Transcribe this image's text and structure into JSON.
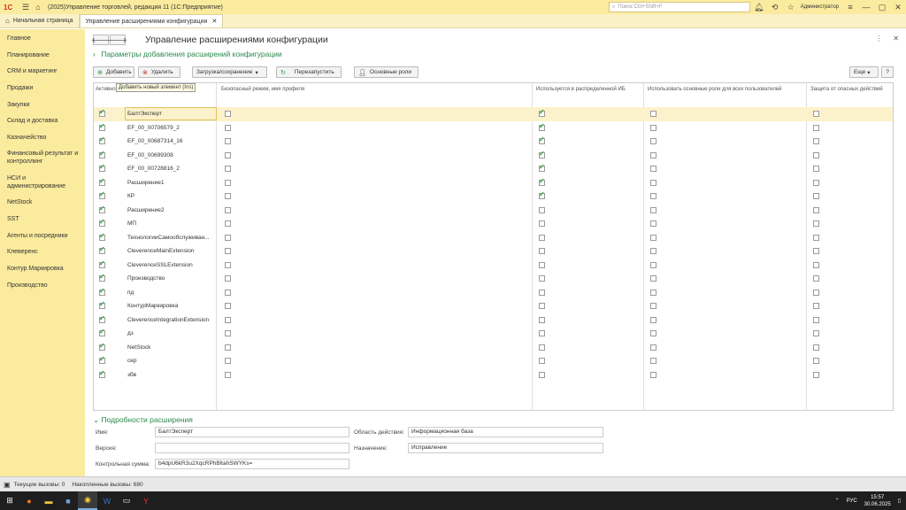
{
  "titlebar": {
    "app_title": "(2025)Управление торговлей, редакция 11  (1С:Предприятие)",
    "search_placeholder": "Поиск Ctrl+Shift+F",
    "user": "Администратор"
  },
  "tabs": [
    {
      "label": "Начальная страница"
    },
    {
      "label": "Управление расширениями конфигурации"
    }
  ],
  "sidebar": {
    "items": [
      {
        "label": "Главное"
      },
      {
        "label": "Планирование"
      },
      {
        "label": "CRM и маркетинг"
      },
      {
        "label": "Продажи"
      },
      {
        "label": "Закупки"
      },
      {
        "label": "Склад и доставка"
      },
      {
        "label": "Казначейство"
      },
      {
        "label": "Финансовый результат и контроллинг"
      },
      {
        "label": "НСИ и администрирование"
      },
      {
        "label": "NetStock"
      },
      {
        "label": "SST"
      },
      {
        "label": "Агенты и посредники"
      },
      {
        "label": "Клеверенс"
      },
      {
        "label": "Контур.Маркировка"
      },
      {
        "label": "Производство"
      }
    ]
  },
  "main": {
    "title": "Управление расширениями конфигурации",
    "params_link": "Параметры добавления расширений конфигурации",
    "buttons": {
      "add": "Добавить",
      "delete": "Удалить",
      "load_save": "Загрузка/сохранение",
      "restart": "Перезапустить",
      "main_roles": "Основные роли",
      "more": "Еще",
      "help": "?"
    },
    "tooltip": "Добавить новый элемент (Ins)",
    "columns": {
      "active": "Активно",
      "safe_mode": "Безопасный режим, имя профиля",
      "used_in_distributed": "Используется в распределенной ИБ",
      "use_main_roles": "Использовать основные роли для всех пользователей",
      "protection": "Защита от опасных действий"
    },
    "rows": [
      {
        "name": "БалтЭксперт",
        "active": true,
        "safe": false,
        "distributed": true,
        "roles": false,
        "protect": false
      },
      {
        "name": "EF_00_00706579_2",
        "active": true,
        "safe": false,
        "distributed": true,
        "roles": false,
        "protect": false
      },
      {
        "name": "EF_00_00687314_16",
        "active": true,
        "safe": false,
        "distributed": true,
        "roles": false,
        "protect": false
      },
      {
        "name": "EF_00_00699308",
        "active": true,
        "safe": false,
        "distributed": true,
        "roles": false,
        "protect": false
      },
      {
        "name": "EF_00_00728816_2",
        "active": true,
        "safe": false,
        "distributed": true,
        "roles": false,
        "protect": false
      },
      {
        "name": "Расширение1",
        "active": true,
        "safe": false,
        "distributed": true,
        "roles": false,
        "protect": false
      },
      {
        "name": "КР",
        "active": true,
        "safe": false,
        "distributed": true,
        "roles": false,
        "protect": false
      },
      {
        "name": "Расширение2",
        "active": true,
        "safe": false,
        "distributed": false,
        "roles": false,
        "protect": false
      },
      {
        "name": "МП",
        "active": true,
        "safe": false,
        "distributed": false,
        "roles": false,
        "protect": false
      },
      {
        "name": "ТехнологииСамообслуживан...",
        "active": true,
        "safe": false,
        "distributed": false,
        "roles": false,
        "protect": false
      },
      {
        "name": "CleverenceMainExtension",
        "active": true,
        "safe": false,
        "distributed": false,
        "roles": false,
        "protect": false
      },
      {
        "name": "CleverenceSSLExtension",
        "active": true,
        "safe": false,
        "distributed": false,
        "roles": false,
        "protect": false
      },
      {
        "name": "Производство",
        "active": true,
        "safe": false,
        "distributed": false,
        "roles": false,
        "protect": false
      },
      {
        "name": "пд",
        "active": true,
        "safe": false,
        "distributed": false,
        "roles": false,
        "protect": false
      },
      {
        "name": "КонтурМаркировка",
        "active": true,
        "safe": false,
        "distributed": false,
        "roles": false,
        "protect": false
      },
      {
        "name": "CleverenceIntegrationExtension",
        "active": true,
        "safe": false,
        "distributed": false,
        "roles": false,
        "protect": false
      },
      {
        "name": "дз",
        "active": true,
        "safe": false,
        "distributed": false,
        "roles": false,
        "protect": false
      },
      {
        "name": "NetStock",
        "active": true,
        "safe": false,
        "distributed": false,
        "roles": false,
        "protect": false
      },
      {
        "name": "сер",
        "active": true,
        "safe": false,
        "distributed": false,
        "roles": false,
        "protect": false
      },
      {
        "name": "збв",
        "active": true,
        "safe": false,
        "distributed": false,
        "roles": false,
        "protect": false
      }
    ],
    "details": {
      "title": "Подробности расширения",
      "name_label": "Имя:",
      "name_value": "БалтЭксперт",
      "version_label": "Версия:",
      "version_value": "",
      "checksum_label": "Контрольная сумма:",
      "checksum_value": "b4dpU6kR3u2XqcRPhBltahSWYKs=",
      "scope_label": "Область действия:",
      "scope_value": "Информационная база",
      "purpose_label": "Назначение:",
      "purpose_value": "Исправление"
    }
  },
  "statusbar": {
    "current_calls": "Текущие вызовы: 0",
    "accumulated_calls": "Накопленные вызовы: 680"
  },
  "taskbar": {
    "lang": "РУС",
    "time": "15:57",
    "date": "30.06.2025"
  },
  "colors": {
    "accent_yellow": "#fbeb9e",
    "link_green": "#2a8a4a",
    "check_green": "#2e9a3e"
  }
}
